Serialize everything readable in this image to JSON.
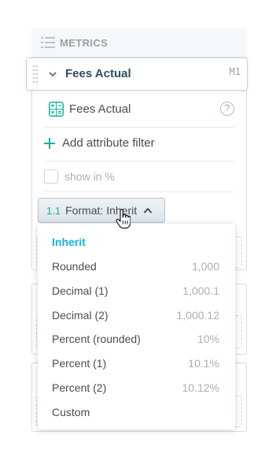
{
  "metrics": {
    "title": "METRICS",
    "item": {
      "title": "Fees Actual",
      "sequence": "M1",
      "measure_name": "Fees Actual",
      "help_glyph": "?",
      "add_filter_label": "Add attribute filter",
      "show_percent_label": "show in %",
      "show_percent_checked": false,
      "format_button": {
        "icon_text": "1.1",
        "label": "Format: Inherit"
      }
    }
  },
  "format_dropdown": {
    "selected": "Inherit",
    "options": [
      {
        "label": "Inherit",
        "preview": ""
      },
      {
        "label": "Rounded",
        "preview": "1,000"
      },
      {
        "label": "Decimal (1)",
        "preview": "1,000.1"
      },
      {
        "label": "Decimal (2)",
        "preview": "1,000.12"
      },
      {
        "label": "Percent (rounded)",
        "preview": "10%"
      },
      {
        "label": "Percent (1)",
        "preview": "10.1%"
      },
      {
        "label": "Percent (2)",
        "preview": "10.12%"
      },
      {
        "label": "Custom",
        "preview": ""
      }
    ]
  },
  "colors": {
    "accent": "#14b2e2",
    "teal": "#14b2a2",
    "border": "#d6dbe0",
    "muted_text": "#a6b1ba"
  },
  "icons": [
    "list-lines-icon",
    "drag-handle-icon",
    "chevron-down-icon",
    "calculator-icon",
    "help-icon",
    "plus-icon",
    "checkbox",
    "format-number-icon",
    "chevron-up-icon",
    "hand-pointer-cursor-icon"
  ]
}
